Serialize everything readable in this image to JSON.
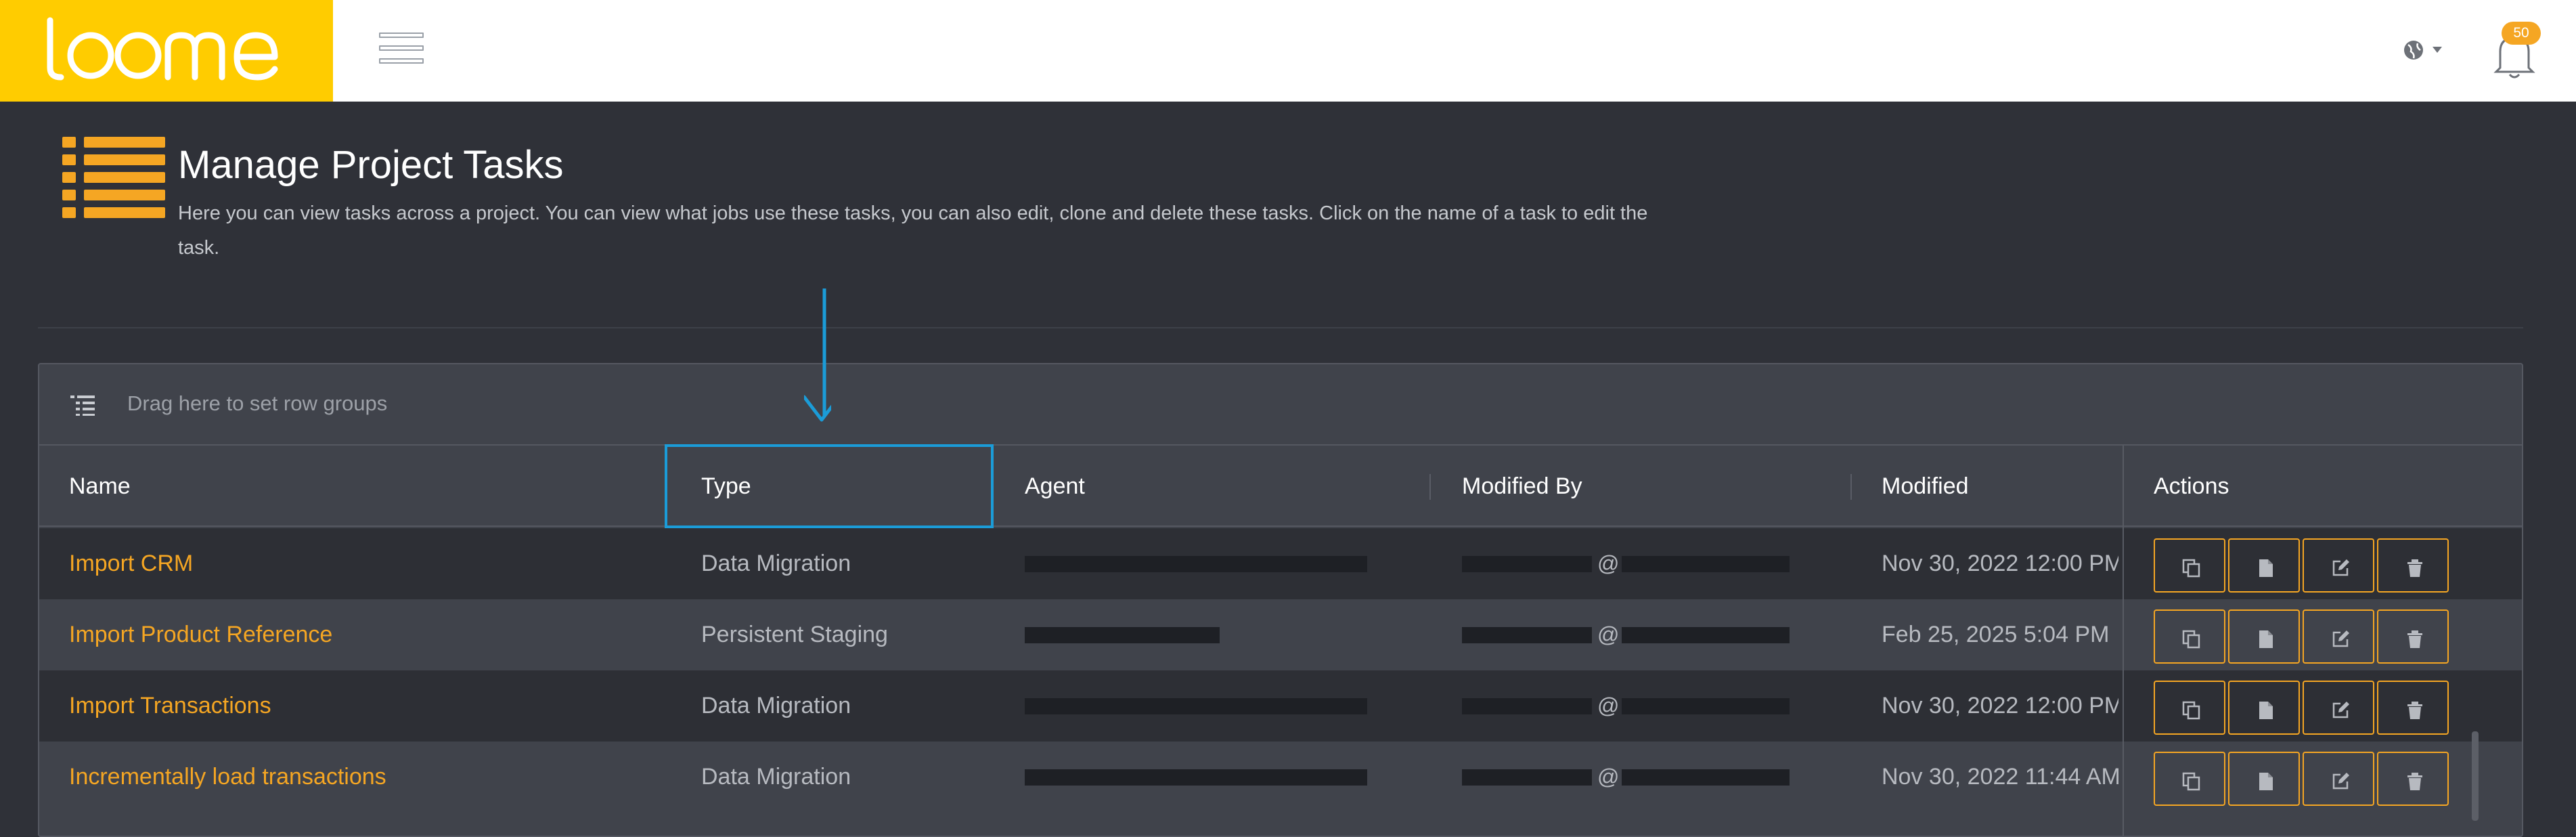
{
  "app": {
    "logo_text": "loome",
    "brand_color": "#ffcc00",
    "accent_color": "#f5a623",
    "highlight_color": "#1b9cd8"
  },
  "topbar": {
    "menu_icon": "hamburger-icon",
    "language_icon": "globe-icon",
    "notifications_icon": "bell-icon",
    "notification_count": "50"
  },
  "header": {
    "icon": "list-icon",
    "title": "Manage Project Tasks",
    "description": "Here you can view tasks across a project. You can view what jobs use these tasks, you can also edit, clone and delete these tasks. Click on the name of a task to edit the task."
  },
  "grid": {
    "group_panel_icon": "row-group-icon",
    "group_panel_text": "Drag here to set row groups",
    "columns": {
      "name": "Name",
      "type": "Type",
      "agent": "Agent",
      "modified_by": "Modified By",
      "modified": "Modified",
      "actions": "Actions"
    },
    "rows": [
      {
        "name": "Import CRM",
        "type": "Data Migration",
        "modified_by_at": "@",
        "modified": "Nov 30, 2022 12:00 PM"
      },
      {
        "name": "Import Product Reference",
        "type": "Persistent Staging",
        "modified_by_at": "@",
        "modified": "Feb 25, 2025 5:04 PM"
      },
      {
        "name": "Import Transactions",
        "type": "Data Migration",
        "modified_by_at": "@",
        "modified": "Nov 30, 2022 12:00 PM"
      },
      {
        "name": "Incrementally load transactions",
        "type": "Data Migration",
        "modified_by_at": "@",
        "modified": "Nov 30, 2022 11:44 AM"
      }
    ],
    "action_icons": [
      "clone-icon",
      "document-icon",
      "edit-icon",
      "delete-icon"
    ]
  }
}
